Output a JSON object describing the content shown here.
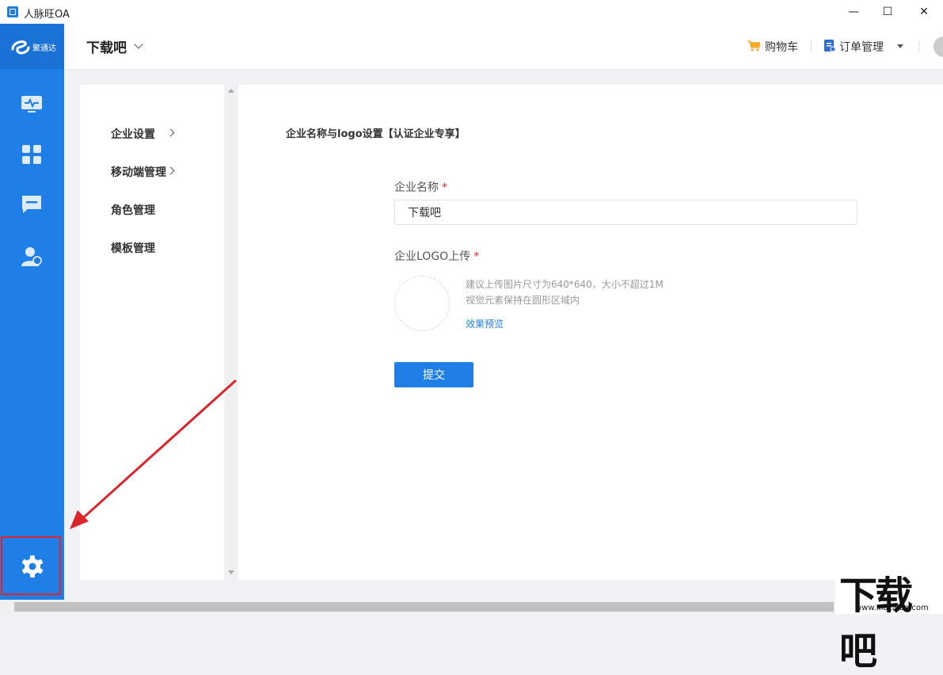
{
  "window": {
    "title": "人脉旺OA",
    "minimize_glyph": "—",
    "maximize_glyph": "☐",
    "close_glyph": "✕"
  },
  "brand": {
    "logo_text": "聚通达"
  },
  "header": {
    "company_name": "下载吧",
    "cart_label": "购物车",
    "orders_label": "订单管理"
  },
  "nav": {
    "icons": [
      "monitor-icon",
      "apps-grid-icon",
      "message-icon",
      "contacts-icon"
    ],
    "settings_icon": "gear-icon",
    "accent": "#1f7fe6"
  },
  "side_menu": {
    "items": [
      {
        "label": "企业设置",
        "has_arrow": true
      },
      {
        "label": "移动端管理",
        "has_arrow": true
      },
      {
        "label": "角色管理",
        "has_arrow": false
      },
      {
        "label": "模板管理",
        "has_arrow": false
      }
    ]
  },
  "form": {
    "section_title": "企业名称与logo设置【认证企业专享】",
    "name_label": "企业名称",
    "name_value": "下载吧",
    "required_mark": "*",
    "logo_label": "企业LOGO上传",
    "logo_hint_1": "建议上传图片尺寸为640*640，大小不超过1M",
    "logo_hint_2": "视觉元素保持在圆形区域内",
    "preview_link": "效果预览",
    "submit_label": "提交"
  },
  "watermark": {
    "big": "下载吧",
    "small": "www.xiazaiba.com"
  }
}
